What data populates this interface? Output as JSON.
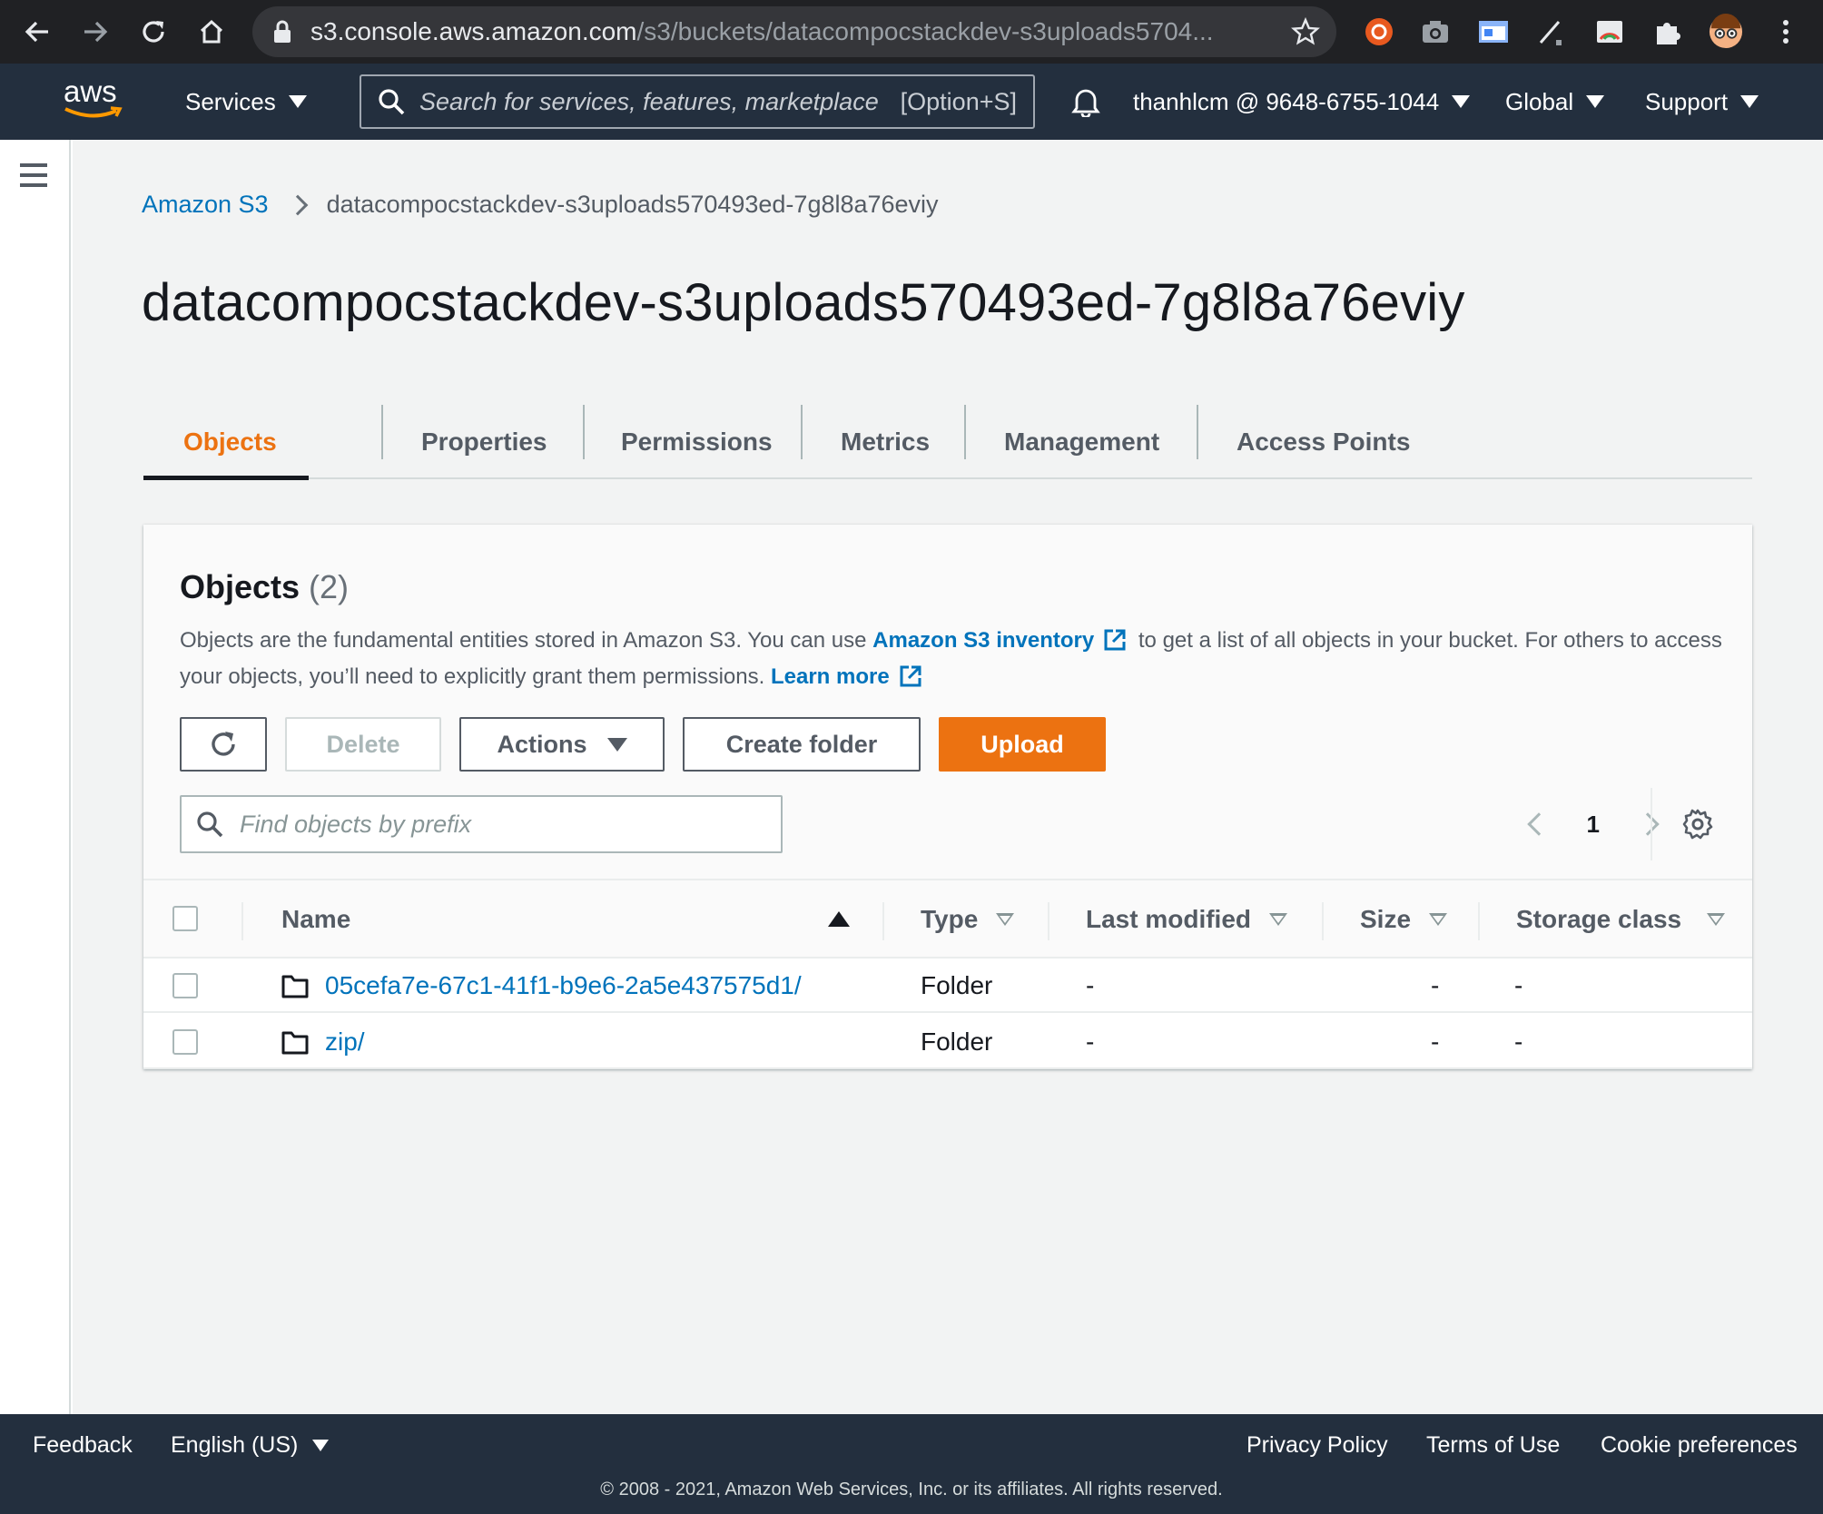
{
  "browser": {
    "url_host": "s3.console.aws.amazon.com",
    "url_path": "/s3/buckets/datacompocstackdev-s3uploads5704..."
  },
  "header": {
    "logo_text": "aws",
    "services_label": "Services",
    "search_placeholder": "Search for services, features, marketplace",
    "search_shortcut": "[Option+S]",
    "account_label": "thanhlcm @ 9648-6755-1044",
    "region_label": "Global",
    "support_label": "Support"
  },
  "breadcrumb": {
    "root": "Amazon S3",
    "current": "datacompocstackdev-s3uploads570493ed-7g8l8a76eviy"
  },
  "page_title": "datacompocstackdev-s3uploads570493ed-7g8l8a76eviy",
  "tabs": [
    {
      "label": "Objects",
      "active": true
    },
    {
      "label": "Properties",
      "active": false
    },
    {
      "label": "Permissions",
      "active": false
    },
    {
      "label": "Metrics",
      "active": false
    },
    {
      "label": "Management",
      "active": false
    },
    {
      "label": "Access Points",
      "active": false
    }
  ],
  "objects_panel": {
    "heading": "Objects",
    "count": "(2)",
    "desc_part1": "Objects are the fundamental entities stored in Amazon S3. You can use ",
    "desc_link1": "Amazon S3 inventory",
    "desc_part2": " to get a list of all objects in your bucket. For others to access your objects, you’ll need to explicitly grant them permissions. ",
    "desc_link2": "Learn more",
    "buttons": {
      "delete": "Delete",
      "actions": "Actions",
      "create_folder": "Create folder",
      "upload": "Upload"
    },
    "filter_placeholder": "Find objects by prefix",
    "page_number": "1",
    "columns": {
      "name": "Name",
      "type": "Type",
      "last_modified": "Last modified",
      "size": "Size",
      "storage_class": "Storage class"
    },
    "rows": [
      {
        "name": "05cefa7e-67c1-41f1-b9e6-2a5e437575d1/",
        "type": "Folder",
        "last_modified": "-",
        "size": "-",
        "storage_class": "-"
      },
      {
        "name": "zip/",
        "type": "Folder",
        "last_modified": "-",
        "size": "-",
        "storage_class": "-"
      }
    ]
  },
  "footer": {
    "feedback": "Feedback",
    "language": "English (US)",
    "privacy": "Privacy Policy",
    "terms": "Terms of Use",
    "cookies": "Cookie preferences",
    "copyright": "© 2008 - 2021, Amazon Web Services, Inc. or its affiliates. All rights reserved."
  },
  "colors": {
    "aws_nav": "#232f3e",
    "accent_orange": "#ec7211",
    "link_blue": "#0073bb"
  }
}
